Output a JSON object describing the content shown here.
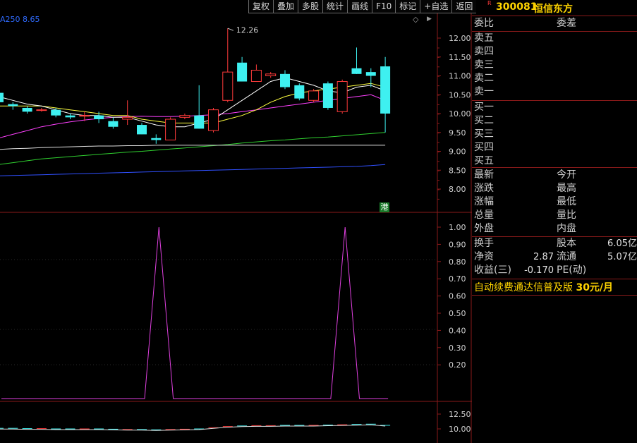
{
  "toolbar": {
    "buttons": [
      "复权",
      "叠加",
      "多股",
      "统计",
      "画线",
      "F10",
      "标记",
      "+自选",
      "返回"
    ]
  },
  "ma_legend": "A250  8.65",
  "price_axis": {
    "ticks": [
      "12.00",
      "11.50",
      "11.00",
      "10.50",
      "10.00",
      "9.50",
      "9.00",
      "8.50",
      "8.00"
    ],
    "high_marker": "12.26"
  },
  "indicator_axis": {
    "ticks": [
      "1.00",
      "0.90",
      "0.80",
      "0.70",
      "0.60",
      "0.50",
      "0.40",
      "0.30",
      "0.20"
    ]
  },
  "volume_axis": {
    "ticks": [
      "12.50",
      "10.00"
    ]
  },
  "badge": "港",
  "stock": {
    "r_mark": "R",
    "code": "300081",
    "name": "恒信东方"
  },
  "quote": {
    "weibi_label": "委比",
    "weicha_label": "委差",
    "sell": [
      "卖五",
      "卖四",
      "卖三",
      "卖二",
      "卖一"
    ],
    "buy": [
      "买一",
      "买二",
      "买三",
      "买四",
      "买五"
    ],
    "left_labels": [
      "最新",
      "涨跌",
      "涨幅",
      "总量",
      "外盘"
    ],
    "right_labels": [
      "今开",
      "最高",
      "最低",
      "量比",
      "内盘"
    ]
  },
  "fundamentals": {
    "turnover_label": "换手",
    "share_capital_label": "股本",
    "share_capital_value": "6.05亿",
    "net_assets_label": "净资",
    "net_assets_value": "2.87",
    "float_label": "流通",
    "float_value": "5.07亿",
    "eps_label": "收益(三)",
    "eps_value": "-0.170",
    "pe_label": "PE(动)"
  },
  "ad": {
    "text": "自动续费通达信普及版",
    "price": "30元/月"
  },
  "colors": {
    "grid_red": "#8a1a1a",
    "up": "#ff3b3b",
    "down": "#3ef0f0",
    "ma5": "#ffffff",
    "ma10": "#ffff40",
    "ma20": "#ff40ff",
    "ma60": "#30d030",
    "ma120": "#e0e0e0",
    "ma250": "#3050ff",
    "indicator": "#e040e0",
    "yellow_text": "#ffd400"
  },
  "chart_data": {
    "type": "candlestick",
    "ohlc": [
      {
        "o": 10.55,
        "h": 10.75,
        "l": 10.25,
        "c": 10.3
      },
      {
        "o": 10.25,
        "h": 10.3,
        "l": 10.1,
        "c": 10.2
      },
      {
        "o": 10.15,
        "h": 10.2,
        "l": 10.0,
        "c": 10.05
      },
      {
        "o": 10.1,
        "h": 10.15,
        "l": 10.05,
        "c": 10.1
      },
      {
        "o": 10.1,
        "h": 10.15,
        "l": 9.9,
        "c": 9.95
      },
      {
        "o": 9.95,
        "h": 10.0,
        "l": 9.85,
        "c": 9.9
      },
      {
        "o": 9.95,
        "h": 10.05,
        "l": 9.8,
        "c": 9.95
      },
      {
        "o": 9.95,
        "h": 10.05,
        "l": 9.75,
        "c": 9.85
      },
      {
        "o": 9.8,
        "h": 9.9,
        "l": 9.6,
        "c": 9.65
      },
      {
        "o": 9.85,
        "h": 10.35,
        "l": 9.7,
        "c": 9.9
      },
      {
        "o": 9.7,
        "h": 9.75,
        "l": 9.45,
        "c": 9.45
      },
      {
        "o": 9.35,
        "h": 9.45,
        "l": 9.2,
        "c": 9.3
      },
      {
        "o": 9.3,
        "h": 9.9,
        "l": 9.3,
        "c": 9.85
      },
      {
        "o": 9.9,
        "h": 10.0,
        "l": 9.85,
        "c": 9.95
      },
      {
        "o": 9.95,
        "h": 10.75,
        "l": 9.6,
        "c": 9.6
      },
      {
        "o": 9.55,
        "h": 10.15,
        "l": 9.5,
        "c": 10.1
      },
      {
        "o": 10.35,
        "h": 12.26,
        "l": 10.3,
        "c": 11.1
      },
      {
        "o": 11.35,
        "h": 11.5,
        "l": 10.85,
        "c": 10.85
      },
      {
        "o": 10.85,
        "h": 11.3,
        "l": 10.85,
        "c": 11.15
      },
      {
        "o": 11.0,
        "h": 11.1,
        "l": 10.95,
        "c": 11.05
      },
      {
        "o": 11.05,
        "h": 11.15,
        "l": 10.65,
        "c": 10.7
      },
      {
        "o": 10.75,
        "h": 10.8,
        "l": 10.35,
        "c": 10.4
      },
      {
        "o": 10.35,
        "h": 10.65,
        "l": 10.3,
        "c": 10.6
      },
      {
        "o": 10.8,
        "h": 10.85,
        "l": 10.1,
        "c": 10.15
      },
      {
        "o": 10.05,
        "h": 10.9,
        "l": 10.0,
        "c": 10.85
      },
      {
        "o": 11.2,
        "h": 11.75,
        "l": 11.05,
        "c": 11.05
      },
      {
        "o": 11.1,
        "h": 11.2,
        "l": 10.7,
        "c": 11.0
      },
      {
        "o": 11.25,
        "h": 11.5,
        "l": 9.5,
        "c": 10.0
      }
    ],
    "y_range": [
      7.5,
      12.5
    ],
    "ma5": [
      10.45,
      10.35,
      10.25,
      10.2,
      10.1,
      10.0,
      9.95,
      9.95,
      9.9,
      9.9,
      9.8,
      9.7,
      9.65,
      9.65,
      9.75,
      9.85,
      10.1,
      10.35,
      10.6,
      10.85,
      10.95,
      10.85,
      10.75,
      10.6,
      10.55,
      10.7,
      10.75,
      10.6
    ],
    "ma10": [
      10.2,
      10.2,
      10.2,
      10.2,
      10.15,
      10.1,
      10.05,
      10.0,
      9.95,
      9.95,
      9.85,
      9.8,
      9.75,
      9.75,
      9.75,
      9.75,
      9.85,
      9.95,
      10.1,
      10.3,
      10.45,
      10.55,
      10.6,
      10.65,
      10.7,
      10.75,
      10.8,
      10.7
    ],
    "ma20": [
      9.35,
      9.45,
      9.55,
      9.65,
      9.72,
      9.78,
      9.83,
      9.87,
      9.9,
      9.92,
      9.93,
      9.92,
      9.92,
      9.93,
      9.95,
      9.97,
      10.0,
      10.05,
      10.1,
      10.15,
      10.2,
      10.25,
      10.3,
      10.35,
      10.4,
      10.45,
      10.5,
      10.35
    ],
    "ma60": [
      8.65,
      8.7,
      8.75,
      8.8,
      8.83,
      8.86,
      8.89,
      8.92,
      8.95,
      8.98,
      9.0,
      9.03,
      9.06,
      9.09,
      9.12,
      9.15,
      9.18,
      9.22,
      9.25,
      9.28,
      9.3,
      9.33,
      9.36,
      9.38,
      9.41,
      9.44,
      9.47,
      9.5
    ],
    "ma120": [
      9.05,
      9.07,
      9.08,
      9.1,
      9.11,
      9.12,
      9.13,
      9.14,
      9.14,
      9.15,
      9.15,
      9.16,
      9.16,
      9.16,
      9.16,
      9.16,
      9.16,
      9.16,
      9.16,
      9.16,
      9.16,
      9.16,
      9.16,
      9.16,
      9.16,
      9.16,
      9.16,
      9.16
    ],
    "ma250": [
      8.35,
      8.36,
      8.37,
      8.38,
      8.39,
      8.4,
      8.41,
      8.42,
      8.43,
      8.44,
      8.45,
      8.46,
      8.47,
      8.48,
      8.49,
      8.5,
      8.51,
      8.52,
      8.53,
      8.54,
      8.55,
      8.56,
      8.57,
      8.58,
      8.59,
      8.6,
      8.62,
      8.65
    ],
    "indicator": [
      0,
      0,
      0,
      0,
      0,
      0,
      0,
      0,
      0,
      0,
      0,
      1,
      0,
      0,
      0,
      0,
      0,
      0,
      0,
      0,
      0,
      0,
      0,
      0,
      1,
      0,
      0,
      0
    ],
    "indicator_range": [
      0.0,
      1.0
    ],
    "volume_line": [
      10.1,
      10.1,
      10.05,
      10.05,
      10.0,
      10.0,
      10.0,
      10.0,
      9.95,
      9.9,
      9.9,
      9.85,
      9.9,
      9.95,
      10.0,
      10.2,
      10.4,
      10.5,
      10.55,
      10.55,
      10.6,
      10.6,
      10.6,
      10.65,
      10.7,
      10.75,
      10.8,
      10.6
    ]
  }
}
